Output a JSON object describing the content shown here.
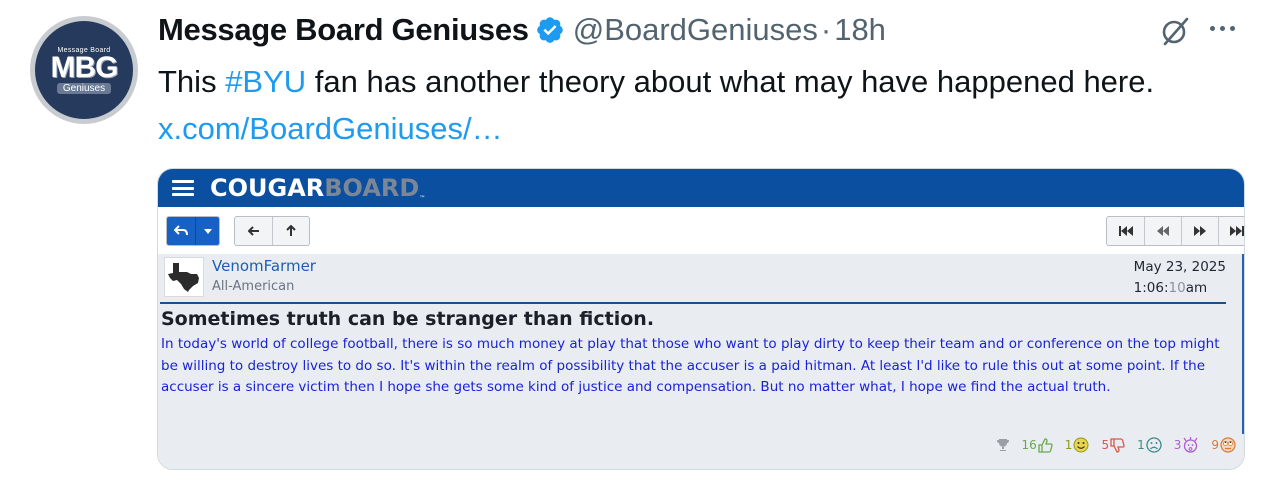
{
  "tweet": {
    "avatar": {
      "top": "Message Board",
      "mid": "MBG",
      "bottom": "Geniuses"
    },
    "display_name": "Message Board Geniuses",
    "handle": "@BoardGeniuses",
    "separator": "·",
    "time": "18h",
    "text_before": "This ",
    "hashtag": "#BYU",
    "text_after": " fan has another theory about what may have happened here. ",
    "link": "x.com/BoardGeniuses/…",
    "colors": {
      "accent": "#1d9bf0",
      "verified": "#1d9bf0"
    }
  },
  "card": {
    "logo_left": "COUGAR",
    "logo_right": "BOARD",
    "logo_tm": "™",
    "colors": {
      "bar": "#0a4fa0",
      "body_text": "#1a22d8"
    },
    "post": {
      "username": "VenomFarmer",
      "user_title": "All-American",
      "date": "May 23, 2025",
      "time_hm": "1:06:",
      "time_sec": "10",
      "time_ampm": "am",
      "title": "Sometimes truth can be stranger than fiction.",
      "body": "In today's world of college football, there is so much money at play that those who want to play dirty to keep their team and or conference on the top might be willing to destroy lives to do so. It's within the realm of possibility that the accuser is a paid hitman. At least I'd like to rule this out at some point. If the accuser is a sincere victim then I hope she gets some kind of justice and compensation. But no matter what, I hope we find the actual truth.",
      "reactions": [
        {
          "icon": "trophy-icon",
          "count": ""
        },
        {
          "icon": "thumbs-up-icon",
          "count": "16"
        },
        {
          "icon": "smile-icon",
          "count": "1"
        },
        {
          "icon": "thumbs-down-icon",
          "count": "5"
        },
        {
          "icon": "frown-icon",
          "count": "1"
        },
        {
          "icon": "mind-blown-icon",
          "count": "3"
        },
        {
          "icon": "eye-roll-icon",
          "count": "9"
        }
      ]
    }
  }
}
